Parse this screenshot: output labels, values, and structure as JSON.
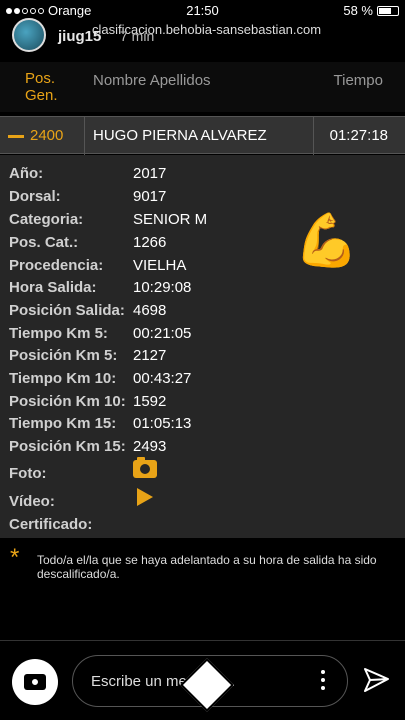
{
  "status_bar": {
    "carrier": "Orange",
    "time": "21:50",
    "battery": "58 %"
  },
  "app_header": {
    "username": "jiug15",
    "post_time": "7 min",
    "url": "clasificacion.behobia-sansebastian.com"
  },
  "table_header": {
    "pos_label": "Pos.",
    "gen_label": "Gen.",
    "name_label": "Nombre Apellidos",
    "time_label": "Tiempo"
  },
  "result": {
    "position": "2400",
    "name": "HUGO PIERNA ALVAREZ",
    "time": "01:27:18"
  },
  "details": [
    {
      "label": "Año:",
      "value": "2017"
    },
    {
      "label": "Dorsal:",
      "value": "9017"
    },
    {
      "label": "Categoria:",
      "value": "SENIOR M"
    },
    {
      "label": "Pos. Cat.:",
      "value": "1266"
    },
    {
      "label": "Procedencia:",
      "value": "VIELHA"
    },
    {
      "label": "Hora Salida:",
      "value": "10:29:08"
    },
    {
      "label": "Posición Salida:",
      "value": "4698"
    },
    {
      "label": "Tiempo Km 5:",
      "value": "00:21:05"
    },
    {
      "label": "Posición Km 5:",
      "value": "2127"
    },
    {
      "label": "Tiempo Km 10:",
      "value": "00:43:27"
    },
    {
      "label": "Posición Km 10:",
      "value": "1592"
    },
    {
      "label": "Tiempo Km 15:",
      "value": "01:05:13"
    },
    {
      "label": "Posición Km 15:",
      "value": "2493"
    }
  ],
  "media": {
    "foto_label": "Foto:",
    "video_label": "Vídeo:",
    "certificado_label": "Certificado:"
  },
  "sticker": "💪",
  "note": {
    "star": "*",
    "text": "Todo/a el/la que se haya adelantado a su hora de salida ha sido descalificado/a."
  },
  "message_bar": {
    "placeholder": "Escribe un mensaje..."
  },
  "colors": {
    "accent": "#e8a317",
    "panel": "#262626",
    "row": "#333333"
  }
}
